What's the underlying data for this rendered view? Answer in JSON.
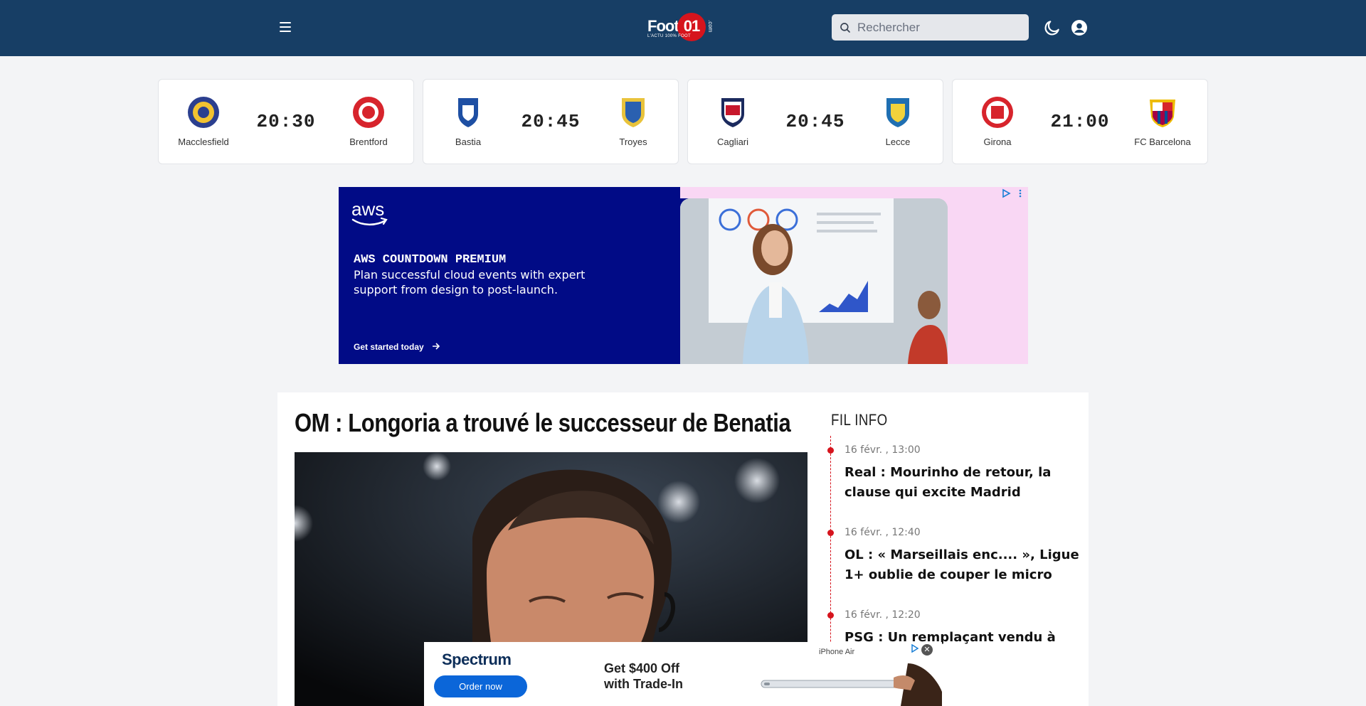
{
  "header": {
    "logo_text": "Foot",
    "logo_number": "01",
    "logo_suffix": ".com",
    "logo_tagline": "L'ACTU 100% FOOT",
    "search_placeholder": "Rechercher",
    "icons": [
      "menu-icon",
      "search-icon",
      "moon-icon",
      "user-icon"
    ]
  },
  "matches": [
    {
      "home": "Macclesfield",
      "away": "Brentford",
      "time": "20:30",
      "home_color": "#f2c230",
      "away_color": "#d7242c"
    },
    {
      "home": "Bastia",
      "away": "Troyes",
      "time": "20:45",
      "home_color": "#1e4fa3",
      "away_color": "#2a60b0"
    },
    {
      "home": "Cagliari",
      "away": "Lecce",
      "time": "20:45",
      "home_color": "#c7182c",
      "away_color": "#1f6fb2"
    },
    {
      "home": "Girona",
      "away": "FC Barcelona",
      "time": "21:00",
      "home_color": "#d7242c",
      "away_color": "#a50044"
    }
  ],
  "ad_banner": {
    "brand": "aws",
    "headline": "AWS COUNTDOWN PREMIUM",
    "body": "Plan successful cloud events with expert support from design to post-launch.",
    "cta": "Get started today",
    "colors": {
      "navy": "#010b86",
      "pink": "#f9d7f4"
    }
  },
  "article": {
    "headline": "OM : Longoria a trouvé le successeur de Benatia"
  },
  "fil_info": {
    "title": "FIL INFO",
    "items": [
      {
        "time": "16 févr. , 13:00",
        "title": "Real : Mourinho de retour, la clause qui excite Madrid"
      },
      {
        "time": "16 févr. , 12:40",
        "title": "OL : « Marseillais enc.... », Ligue 1+ oublie de couper le micro"
      },
      {
        "time": "16 févr. , 12:20",
        "title": "PSG : Un remplaçant vendu à prix énorme"
      }
    ]
  },
  "sticky_ad": {
    "brand": "Spectrum",
    "cta": "Order now",
    "offer": "Get $400 Off\nwith Trade-In",
    "product": "iPhone Air",
    "close": "✕"
  },
  "colors": {
    "header_bg": "#173e65",
    "accent_red": "#d6141d"
  }
}
